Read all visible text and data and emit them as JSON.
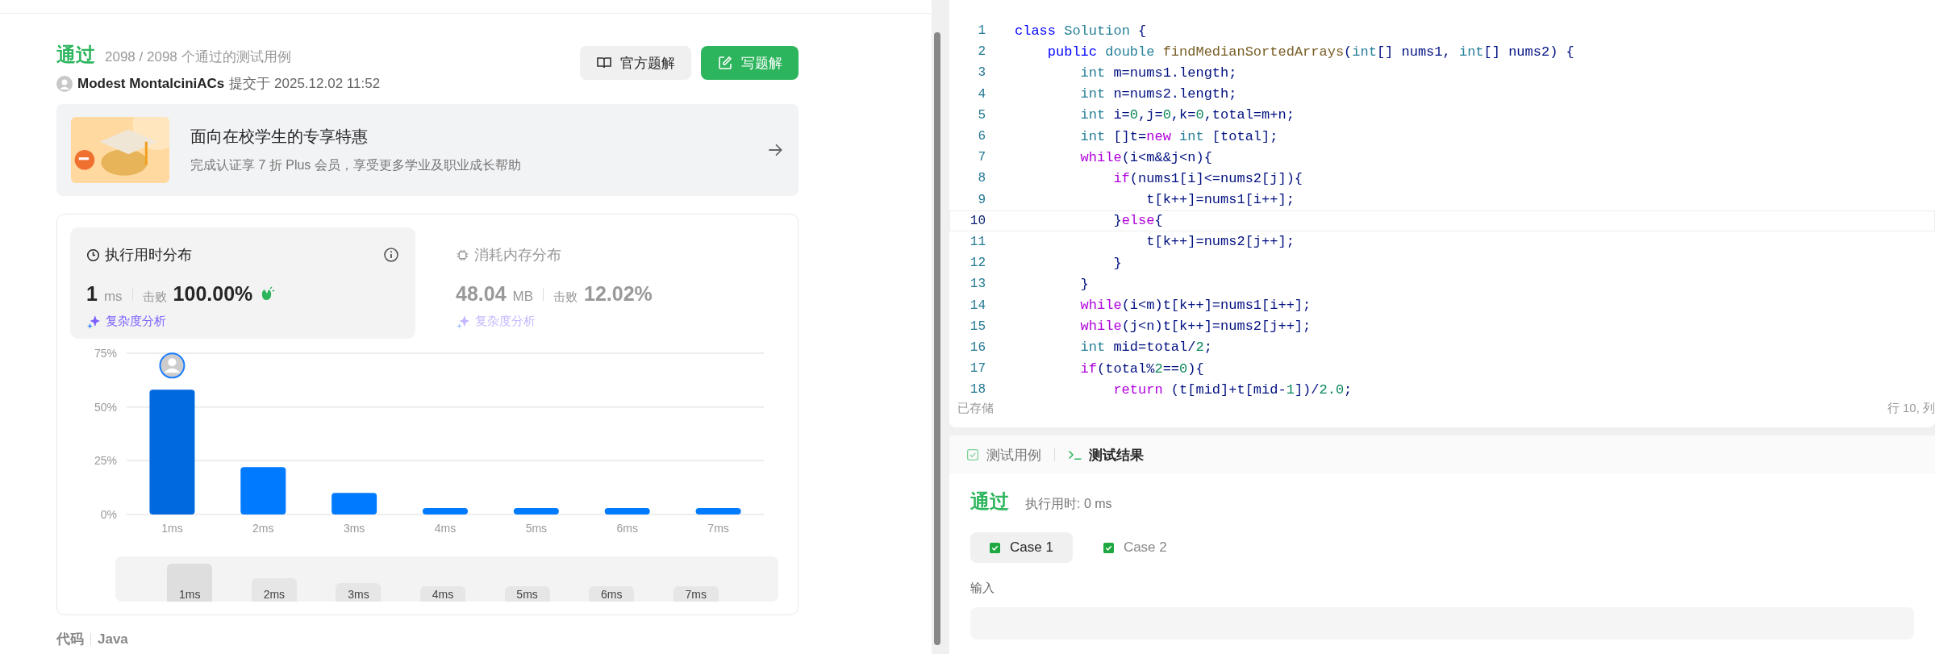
{
  "result": {
    "status": "通过",
    "cases": "2098 / 2098 个通过的测试用例",
    "author": "Modest MontalciniACs",
    "submitted": "提交于 2025.12.02 11:52"
  },
  "buttons": [
    {
      "label": "官方题解",
      "kind": "book"
    },
    {
      "label": "写题解",
      "kind": "edit"
    }
  ],
  "promo": {
    "title": "面向在校学生的专享特惠",
    "subtitle": "完成认证享 7 折 Plus 会员，享受更多学业及职业成长帮助"
  },
  "stats": [
    {
      "title": "执行用时分布",
      "value": "1",
      "unit": "ms",
      "beat_label": "击败",
      "beat": "100.00%",
      "link": "复杂度分析",
      "selected": true
    },
    {
      "title": "消耗内存分布",
      "value": "48.04",
      "unit": "MB",
      "beat_label": "击败",
      "beat": "12.02%",
      "link": "复杂度分析",
      "selected": false
    }
  ],
  "chart": {
    "chart_data": {
      "type": "bar",
      "categories": [
        "1ms",
        "2ms",
        "3ms",
        "4ms",
        "5ms",
        "6ms",
        "7ms"
      ],
      "values": [
        58,
        22,
        10,
        3,
        3,
        3,
        3
      ],
      "ylim": [
        0,
        75
      ],
      "yticks": [
        {
          "value": 0,
          "label": "0%"
        },
        {
          "value": 25,
          "label": "25%"
        },
        {
          "value": 50,
          "label": "50%"
        },
        {
          "value": 75,
          "label": "75%"
        }
      ]
    }
  },
  "range": [
    "1ms",
    "2ms",
    "3ms",
    "4ms",
    "5ms",
    "6ms",
    "7ms"
  ],
  "code_section": {
    "title": "代码",
    "language": "Java"
  },
  "editor": {
    "lines": [
      {
        "n": "1",
        "current": false,
        "tokens": [
          {
            "kind": "kw",
            "t": "class"
          },
          {
            "kind": "cls",
            "t": " Solution"
          },
          {
            "kind": "p",
            "t": " {"
          }
        ]
      },
      {
        "n": "2",
        "current": false,
        "tokens": [
          {
            "kind": "kw",
            "t": "    public"
          },
          {
            "kind": "type",
            "t": " double"
          },
          {
            "kind": "fn",
            "t": " findMedianSortedArrays"
          },
          {
            "kind": "p",
            "t": "("
          },
          {
            "kind": "type",
            "t": "int"
          },
          {
            "kind": "p",
            "t": "[] nums1, "
          },
          {
            "kind": "type",
            "t": "int"
          },
          {
            "kind": "p",
            "t": "[] nums2) {"
          }
        ]
      },
      {
        "n": "3",
        "current": false,
        "tokens": [
          {
            "kind": "type",
            "t": "        int"
          },
          {
            "kind": "p",
            "t": " m=nums1.length;"
          }
        ]
      },
      {
        "n": "4",
        "current": false,
        "tokens": [
          {
            "kind": "type",
            "t": "        int"
          },
          {
            "kind": "p",
            "t": " n=nums2.length;"
          }
        ]
      },
      {
        "n": "5",
        "current": false,
        "tokens": [
          {
            "kind": "type",
            "t": "        int"
          },
          {
            "kind": "p",
            "t": " i="
          },
          {
            "kind": "num",
            "t": "0"
          },
          {
            "kind": "p",
            "t": ",j="
          },
          {
            "kind": "num",
            "t": "0"
          },
          {
            "kind": "p",
            "t": ",k="
          },
          {
            "kind": "num",
            "t": "0"
          },
          {
            "kind": "p",
            "t": ",total=m+n;"
          }
        ]
      },
      {
        "n": "6",
        "current": false,
        "tokens": [
          {
            "kind": "type",
            "t": "        int"
          },
          {
            "kind": "p",
            "t": " []t="
          },
          {
            "kind": "ctrl",
            "t": "new"
          },
          {
            "kind": "type",
            "t": " int"
          },
          {
            "kind": "p",
            "t": " [total];"
          }
        ]
      },
      {
        "n": "7",
        "current": false,
        "tokens": [
          {
            "kind": "ctrl",
            "t": "        while"
          },
          {
            "kind": "p",
            "t": "(i<m&&j<n){"
          }
        ]
      },
      {
        "n": "8",
        "current": false,
        "tokens": [
          {
            "kind": "ctrl",
            "t": "            if"
          },
          {
            "kind": "p",
            "t": "(nums1[i]<=nums2[j]){"
          }
        ]
      },
      {
        "n": "9",
        "current": false,
        "tokens": [
          {
            "kind": "p",
            "t": "                t[k++]=nums1[i++];"
          }
        ]
      },
      {
        "n": "10",
        "current": true,
        "tokens": [
          {
            "kind": "p",
            "t": "            }"
          },
          {
            "kind": "ctrl",
            "t": "else"
          },
          {
            "kind": "p",
            "t": "{"
          }
        ]
      },
      {
        "n": "11",
        "current": false,
        "tokens": [
          {
            "kind": "p",
            "t": "                t[k++]=nums2[j++];"
          }
        ]
      },
      {
        "n": "12",
        "current": false,
        "tokens": [
          {
            "kind": "p",
            "t": "            }"
          }
        ]
      },
      {
        "n": "13",
        "current": false,
        "tokens": [
          {
            "kind": "p",
            "t": "        }"
          }
        ]
      },
      {
        "n": "14",
        "current": false,
        "tokens": [
          {
            "kind": "ctrl",
            "t": "        while"
          },
          {
            "kind": "p",
            "t": "(i<m)t[k++]=nums1[i++];"
          }
        ]
      },
      {
        "n": "15",
        "current": false,
        "tokens": [
          {
            "kind": "ctrl",
            "t": "        while"
          },
          {
            "kind": "p",
            "t": "(j<n)t[k++]=nums2[j++];"
          }
        ]
      },
      {
        "n": "16",
        "current": false,
        "tokens": [
          {
            "kind": "type",
            "t": "        int"
          },
          {
            "kind": "p",
            "t": " mid=total/"
          },
          {
            "kind": "num",
            "t": "2"
          },
          {
            "kind": "p",
            "t": ";"
          }
        ]
      },
      {
        "n": "17",
        "current": false,
        "tokens": [
          {
            "kind": "ctrl",
            "t": "        if"
          },
          {
            "kind": "p",
            "t": "(total%"
          },
          {
            "kind": "num",
            "t": "2"
          },
          {
            "kind": "p",
            "t": "=="
          },
          {
            "kind": "num",
            "t": "0"
          },
          {
            "kind": "p",
            "t": "){"
          }
        ]
      },
      {
        "n": "18",
        "current": false,
        "tokens": [
          {
            "kind": "ctrl",
            "t": "            return"
          },
          {
            "kind": "p",
            "t": " (t[mid]+t[mid-"
          },
          {
            "kind": "num",
            "t": "1"
          },
          {
            "kind": "p",
            "t": "])/"
          },
          {
            "kind": "num",
            "t": "2.0"
          },
          {
            "kind": "p",
            "t": ";"
          }
        ]
      }
    ],
    "status_left": "已存储",
    "status_right": "行 10, 列"
  },
  "console": {
    "tabs": [
      {
        "label": "测试用例",
        "kind": "check",
        "selected": false
      },
      {
        "label": "测试结果",
        "kind": "terminal",
        "selected": true
      }
    ],
    "status": "通过",
    "runtime": "执行用时: 0 ms",
    "cases": [
      {
        "label": "Case 1",
        "selected": true
      },
      {
        "label": "Case 2",
        "selected": false
      }
    ],
    "input_label": "输入"
  }
}
